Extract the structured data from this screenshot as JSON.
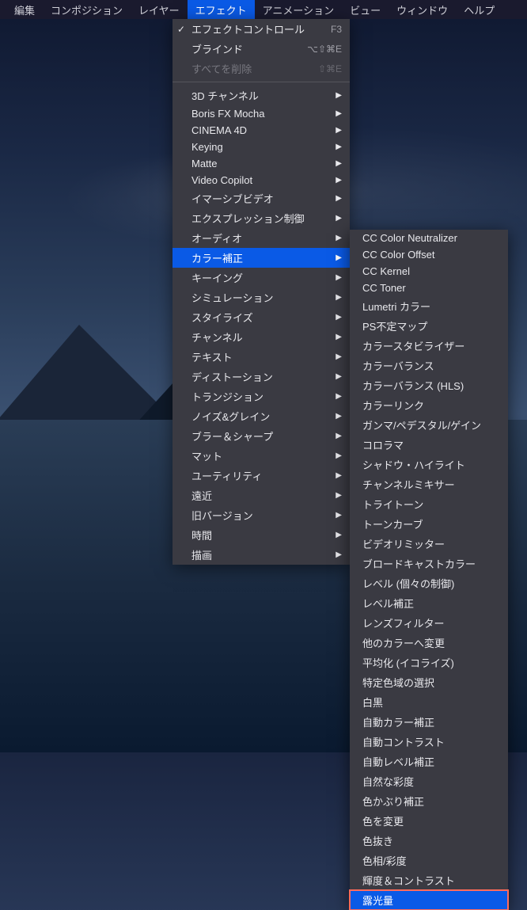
{
  "menubar": {
    "items": [
      {
        "label": "編集"
      },
      {
        "label": "コンポジション"
      },
      {
        "label": "レイヤー"
      },
      {
        "label": "エフェクト",
        "active": true
      },
      {
        "label": "アニメーション"
      },
      {
        "label": "ビュー"
      },
      {
        "label": "ウィンドウ"
      },
      {
        "label": "ヘルプ"
      }
    ]
  },
  "effects_menu": {
    "top": [
      {
        "label": "エフェクトコントロール",
        "shortcut": "F3",
        "checked": true
      },
      {
        "label": "ブラインド",
        "shortcut": "⌥⇧⌘E"
      },
      {
        "label": "すべてを削除",
        "shortcut": "⇧⌘E",
        "disabled": true
      }
    ],
    "categories": [
      {
        "label": "3D チャンネル",
        "submenu": true
      },
      {
        "label": "Boris FX Mocha",
        "submenu": true
      },
      {
        "label": "CINEMA 4D",
        "submenu": true
      },
      {
        "label": "Keying",
        "submenu": true
      },
      {
        "label": "Matte",
        "submenu": true
      },
      {
        "label": "Video Copilot",
        "submenu": true
      },
      {
        "label": "イマーシブビデオ",
        "submenu": true
      },
      {
        "label": "エクスプレッション制御",
        "submenu": true
      },
      {
        "label": "オーディオ",
        "submenu": true
      },
      {
        "label": "カラー補正",
        "submenu": true,
        "highlighted": true
      },
      {
        "label": "キーイング",
        "submenu": true
      },
      {
        "label": "シミュレーション",
        "submenu": true
      },
      {
        "label": "スタイライズ",
        "submenu": true
      },
      {
        "label": "チャンネル",
        "submenu": true
      },
      {
        "label": "テキスト",
        "submenu": true
      },
      {
        "label": "ディストーション",
        "submenu": true
      },
      {
        "label": "トランジション",
        "submenu": true
      },
      {
        "label": "ノイズ&グレイン",
        "submenu": true
      },
      {
        "label": "ブラー＆シャープ",
        "submenu": true
      },
      {
        "label": "マット",
        "submenu": true
      },
      {
        "label": "ユーティリティ",
        "submenu": true
      },
      {
        "label": "遠近",
        "submenu": true
      },
      {
        "label": "旧バージョン",
        "submenu": true
      },
      {
        "label": "時間",
        "submenu": true
      },
      {
        "label": "描画",
        "submenu": true
      }
    ]
  },
  "color_correction_submenu": {
    "items": [
      {
        "label": "CC Color Neutralizer"
      },
      {
        "label": "CC Color Offset"
      },
      {
        "label": "CC Kernel"
      },
      {
        "label": "CC Toner"
      },
      {
        "label": "Lumetri カラー"
      },
      {
        "label": "PS不定マップ"
      },
      {
        "label": "カラースタビライザー"
      },
      {
        "label": "カラーバランス"
      },
      {
        "label": "カラーバランス (HLS)"
      },
      {
        "label": "カラーリンク"
      },
      {
        "label": "ガンマ/ペデスタル/ゲイン"
      },
      {
        "label": "コロラマ"
      },
      {
        "label": "シャドウ・ハイライト"
      },
      {
        "label": "チャンネルミキサー"
      },
      {
        "label": "トライトーン"
      },
      {
        "label": "トーンカーブ"
      },
      {
        "label": "ビデオリミッター"
      },
      {
        "label": "ブロードキャストカラー"
      },
      {
        "label": "レベル (個々の制御)"
      },
      {
        "label": "レベル補正"
      },
      {
        "label": "レンズフィルター"
      },
      {
        "label": "他のカラーへ変更"
      },
      {
        "label": "平均化 (イコライズ)"
      },
      {
        "label": "特定色域の選択"
      },
      {
        "label": "白黒"
      },
      {
        "label": "自動カラー補正"
      },
      {
        "label": "自動コントラスト"
      },
      {
        "label": "自動レベル補正"
      },
      {
        "label": "自然な彩度"
      },
      {
        "label": "色かぶり補正"
      },
      {
        "label": "色を変更"
      },
      {
        "label": "色抜き"
      },
      {
        "label": "色相/彩度"
      },
      {
        "label": "輝度＆コントラスト"
      },
      {
        "label": "露光量",
        "boxed": true
      }
    ]
  }
}
